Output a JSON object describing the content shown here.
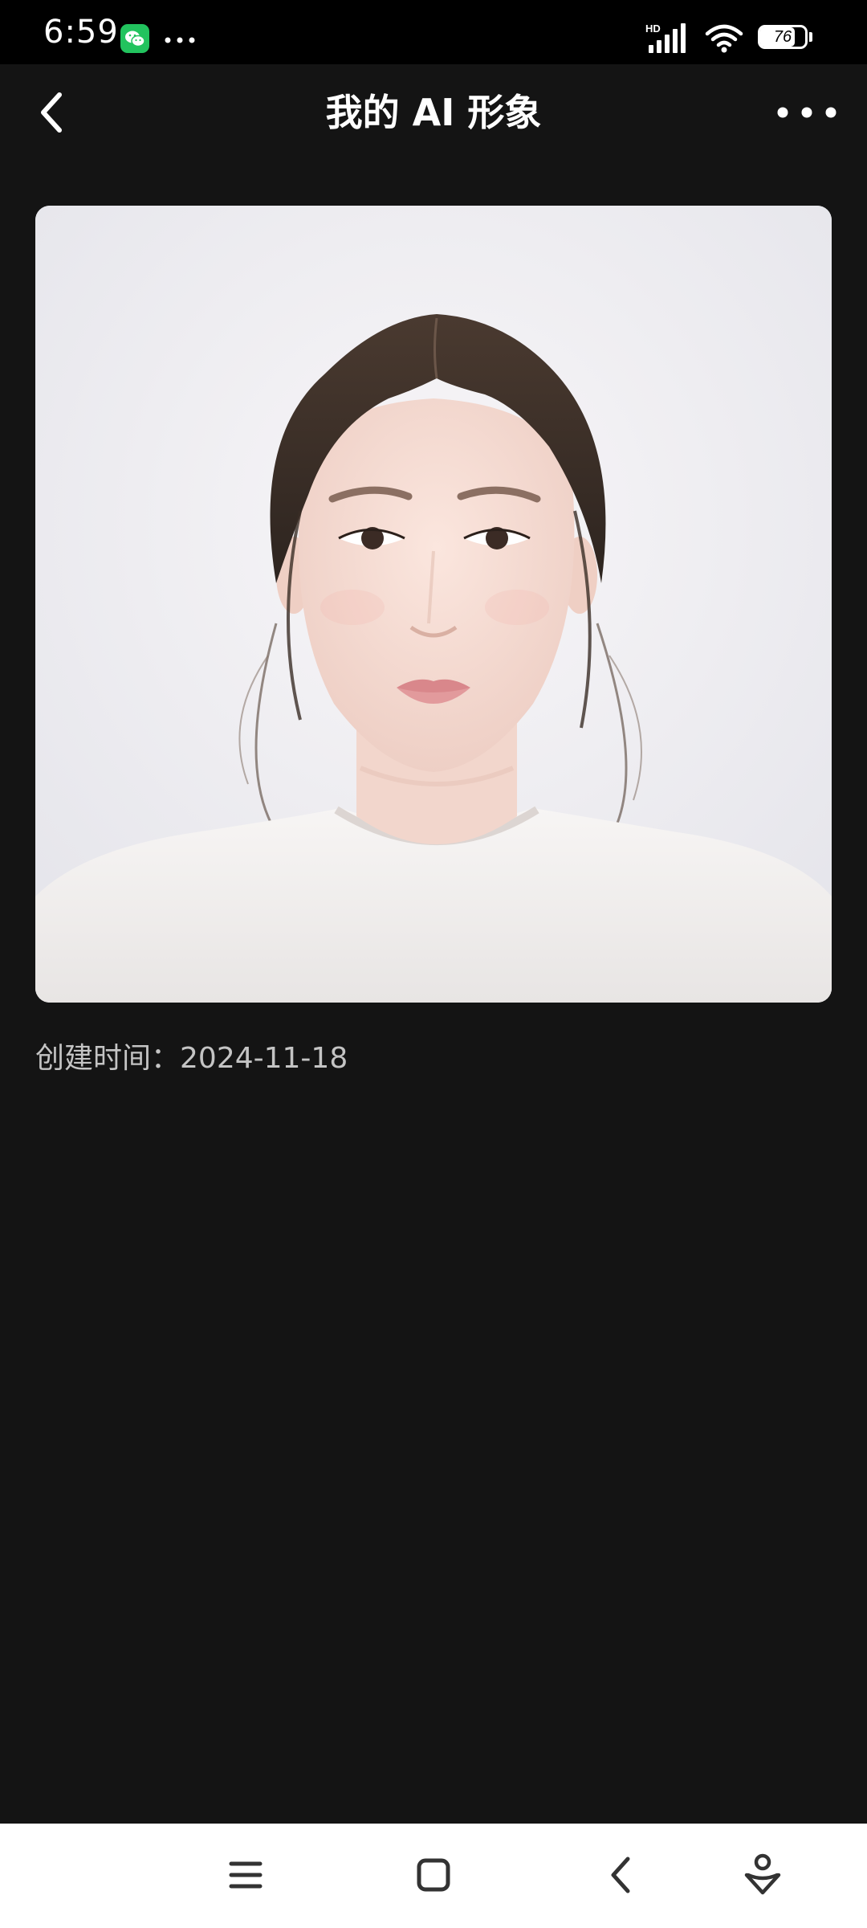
{
  "status_bar": {
    "time": "6:59",
    "battery_level": "76",
    "battery_fraction": 0.76,
    "network_badge": "HD",
    "notification_icons": [
      "wechat-icon",
      "more-dots-icon"
    ]
  },
  "nav": {
    "title": "我的 AI 形象",
    "back_icon": "chevron-left-icon",
    "more_icon": "more-horizontal-icon"
  },
  "avatar": {
    "alt": "AI generated portrait"
  },
  "meta": {
    "created_label": "创建时间：",
    "created_date": "2024-11-18"
  },
  "system_nav": {
    "buttons": [
      "menu-icon",
      "home-icon",
      "back-icon",
      "assistant-icon"
    ]
  },
  "colors": {
    "background": "#141414",
    "status_bar": "#000000",
    "wechat_green": "#22c35e",
    "secondary_text": "#c4c4c4",
    "system_nav_bg": "#ffffff"
  }
}
